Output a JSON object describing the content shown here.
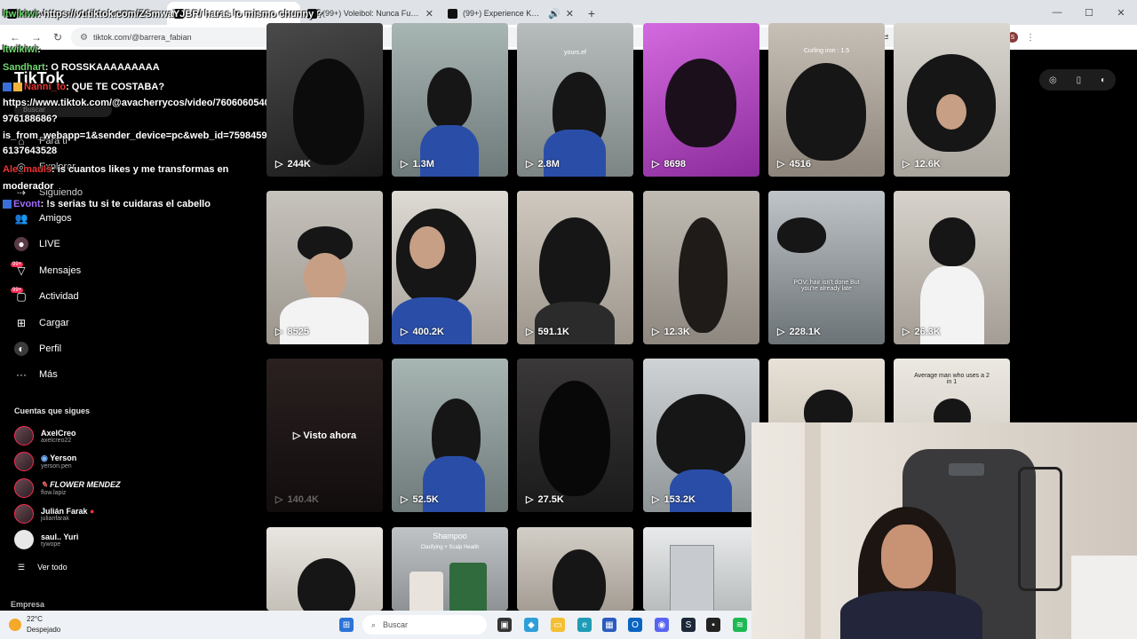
{
  "browser": {
    "tabs": [
      {
        "title": "ltwikiwi: https://vt.tiktok.com/ZSmwa...",
        "active": false
      },
      {
        "title": "",
        "active": true
      },
      {
        "title": "(99+) Voleibol: Nunca Fuimos N",
        "active": false
      },
      {
        "title": "(99+) Experience KATSU Da",
        "active": false
      }
    ],
    "url": "tiktok.com/@barrera_fabian",
    "profile_letter": "S"
  },
  "chat": [
    {
      "user": "ltwikiwi",
      "text": ": https://vt.tiktok.com/ZSmwaYJBR/ haras lo mismo chunny ?"
    },
    {
      "user": "ltwikiwi",
      "text": ":"
    },
    {
      "user": "Sandhart",
      "text": ": O ROSSKAAAAAAAAA"
    },
    {
      "user": "Nanni_to",
      "text": ": QUE TE COSTABA?"
    },
    {
      "user": "",
      "text": "https://www.tiktok.com/@avacherrycos/video/7606060540"
    },
    {
      "user": "",
      "text": "976188686?"
    },
    {
      "user": "",
      "text": "is_from_webapp=1&sender_device=pc&web_id=759845945"
    },
    {
      "user": "",
      "text": "6137643528"
    },
    {
      "user": "Ale_mauls",
      "text": ": is cuantos likes y me transformas en"
    },
    {
      "user": "",
      "text": "moderador"
    },
    {
      "user": "Evont",
      "text": ": !s serias tu si te cuidaras el cabello"
    }
  ],
  "sidebar": {
    "logo": "TikTok",
    "search_placeholder": "Buscar",
    "nav": [
      {
        "label": "Para ti",
        "icon": "home-icon"
      },
      {
        "label": "Explorar",
        "icon": "compass-icon"
      },
      {
        "label": "Siguiendo",
        "icon": "following-icon"
      },
      {
        "label": "Amigos",
        "icon": "friends-icon"
      },
      {
        "label": "LIVE",
        "icon": "live-icon"
      },
      {
        "label": "Mensajes",
        "icon": "messages-icon",
        "badge": "99+"
      },
      {
        "label": "Actividad",
        "icon": "activity-icon",
        "badge": "99+"
      },
      {
        "label": "Cargar",
        "icon": "upload-icon"
      },
      {
        "label": "Perfil",
        "icon": "profile-icon"
      },
      {
        "label": "Más",
        "icon": "more-icon"
      }
    ],
    "following_title": "Cuentas que sigues",
    "following": [
      {
        "name": "AxelCreo",
        "handle": "axelcreo22"
      },
      {
        "name": "Yerson",
        "handle": "yerson.pen"
      },
      {
        "name": "FLOWER MENDEZ",
        "handle": "flow.lapiz"
      },
      {
        "name": "Julián Farak",
        "handle": "julianfarak"
      },
      {
        "name": "saul.. Yuri",
        "handle": "tywope"
      }
    ],
    "see_all": "Ver todo",
    "footer": "Empresa"
  },
  "grid": {
    "rows": [
      [
        {
          "count": "244K",
          "caption": ""
        },
        {
          "count": "1.3M",
          "caption": ""
        },
        {
          "count": "2.8M",
          "caption": "yours.ef"
        },
        {
          "count": "8698",
          "caption": ""
        },
        {
          "count": "4516",
          "caption": "Curling iron : 1.5"
        },
        {
          "count": "12.6K",
          "caption": ""
        }
      ],
      [
        {
          "count": "8525",
          "caption": ""
        },
        {
          "count": "400.2K",
          "caption": ""
        },
        {
          "count": "591.1K",
          "caption": ""
        },
        {
          "count": "12.3K",
          "caption": ""
        },
        {
          "count": "228.1K",
          "caption": "POV: hair isn't done But you're already late"
        },
        {
          "count": "26.3K",
          "caption": ""
        }
      ],
      [
        {
          "count": "140.4K",
          "caption": "",
          "overlay": "Visto ahora"
        },
        {
          "count": "52.5K",
          "caption": ""
        },
        {
          "count": "27.5K",
          "caption": ""
        },
        {
          "count": "153.2K",
          "caption": ""
        },
        {
          "count": "",
          "caption": ""
        },
        {
          "count": "",
          "caption": "Average man who uses a 2 in 1"
        }
      ],
      [
        {
          "count": "",
          "caption": ""
        },
        {
          "count": "",
          "caption": "Shampoo",
          "sub": "Clarifying + Scalp Health"
        },
        {
          "count": "",
          "caption": ""
        },
        {
          "count": "",
          "caption": ""
        }
      ]
    ]
  },
  "taskbar": {
    "temp": "22°C",
    "weather": "Despejado",
    "search": "Buscar"
  }
}
